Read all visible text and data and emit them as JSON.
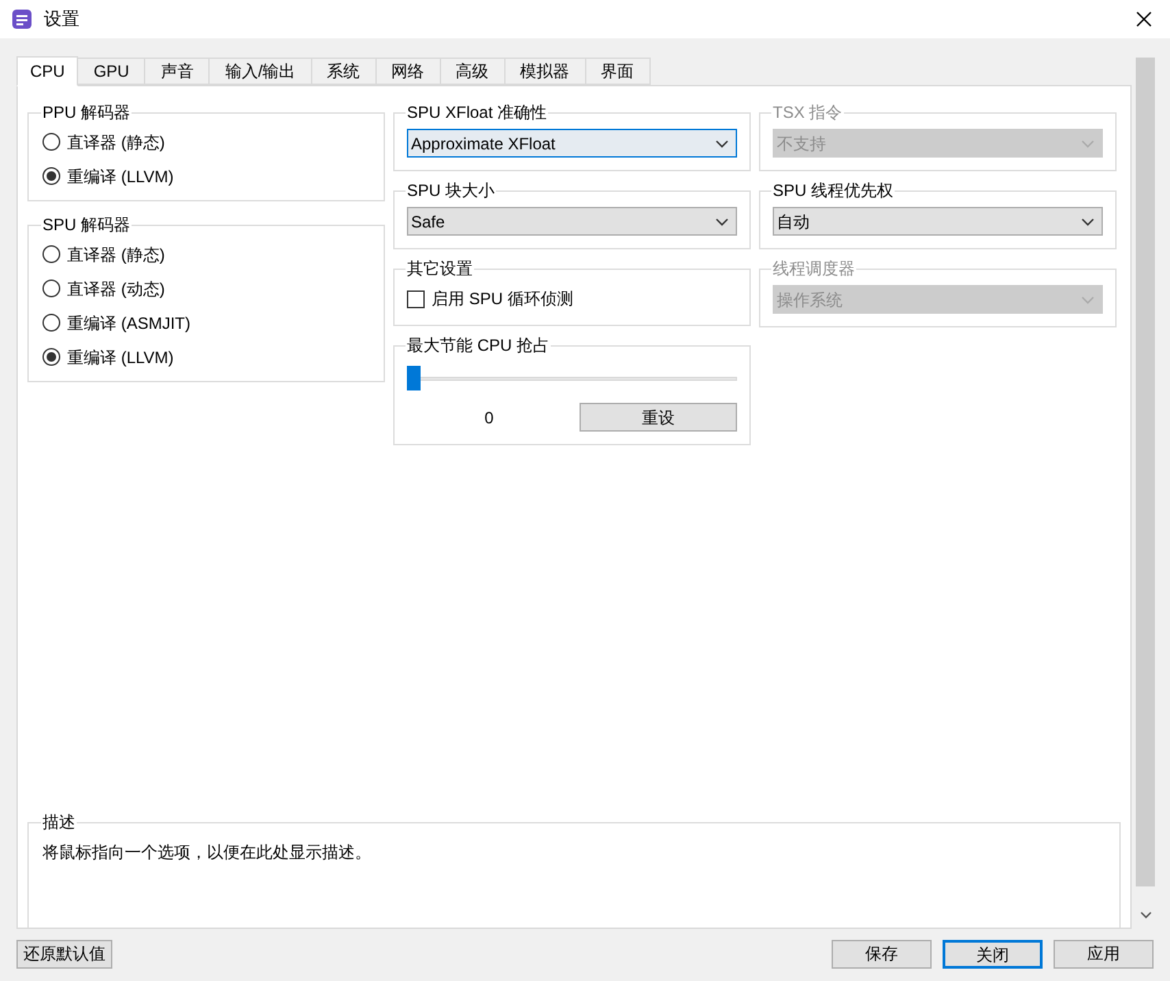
{
  "window": {
    "title": "设置"
  },
  "tabs": [
    {
      "label": "CPU",
      "selected": true
    },
    {
      "label": "GPU",
      "selected": false
    },
    {
      "label": "声音",
      "selected": false
    },
    {
      "label": "输入/输出",
      "selected": false
    },
    {
      "label": "系统",
      "selected": false
    },
    {
      "label": "网络",
      "selected": false
    },
    {
      "label": "高级",
      "selected": false
    },
    {
      "label": "模拟器",
      "selected": false
    },
    {
      "label": "界面",
      "selected": false
    }
  ],
  "ppu_decoder": {
    "title": "PPU 解码器",
    "options": [
      {
        "label": "直译器 (静态)",
        "selected": false
      },
      {
        "label": "重编译 (LLVM)",
        "selected": true
      }
    ]
  },
  "spu_decoder": {
    "title": "SPU 解码器",
    "options": [
      {
        "label": "直译器 (静态)",
        "selected": false
      },
      {
        "label": "直译器 (动态)",
        "selected": false
      },
      {
        "label": "重编译 (ASMJIT)",
        "selected": false
      },
      {
        "label": "重编译 (LLVM)",
        "selected": true
      }
    ]
  },
  "xfloat": {
    "title": "SPU XFloat 准确性",
    "value": "Approximate XFloat",
    "focused": true,
    "disabled": false
  },
  "block_size": {
    "title": "SPU 块大小",
    "value": "Safe",
    "focused": false,
    "disabled": false
  },
  "other_settings": {
    "title": "其它设置",
    "checkboxes": [
      {
        "label": "启用 SPU 循环侦测",
        "checked": false
      }
    ]
  },
  "max_power_saving": {
    "title": "最大节能 CPU 抢占",
    "level": 0,
    "reading": "0",
    "reset_button": "重设"
  },
  "tsx": {
    "title": "TSX 指令",
    "value": "不支持",
    "disabled": true
  },
  "thread_priority": {
    "title": "SPU 线程优先权",
    "value": "自动",
    "focused": false,
    "disabled": false
  },
  "thread_scheduler": {
    "title": "线程调度器",
    "value": "操作系统",
    "disabled": true
  },
  "description": {
    "title": "描述",
    "text": "将鼠标指向一个选项，以便在此处显示描述。"
  },
  "buttons": [
    {
      "label": "还原默认值",
      "kind": "left",
      "default": false
    },
    {
      "label": "保存",
      "kind": "right",
      "default": false
    },
    {
      "label": "关闭",
      "kind": "right",
      "default": true
    },
    {
      "label": "应用",
      "kind": "right",
      "default": false
    }
  ]
}
